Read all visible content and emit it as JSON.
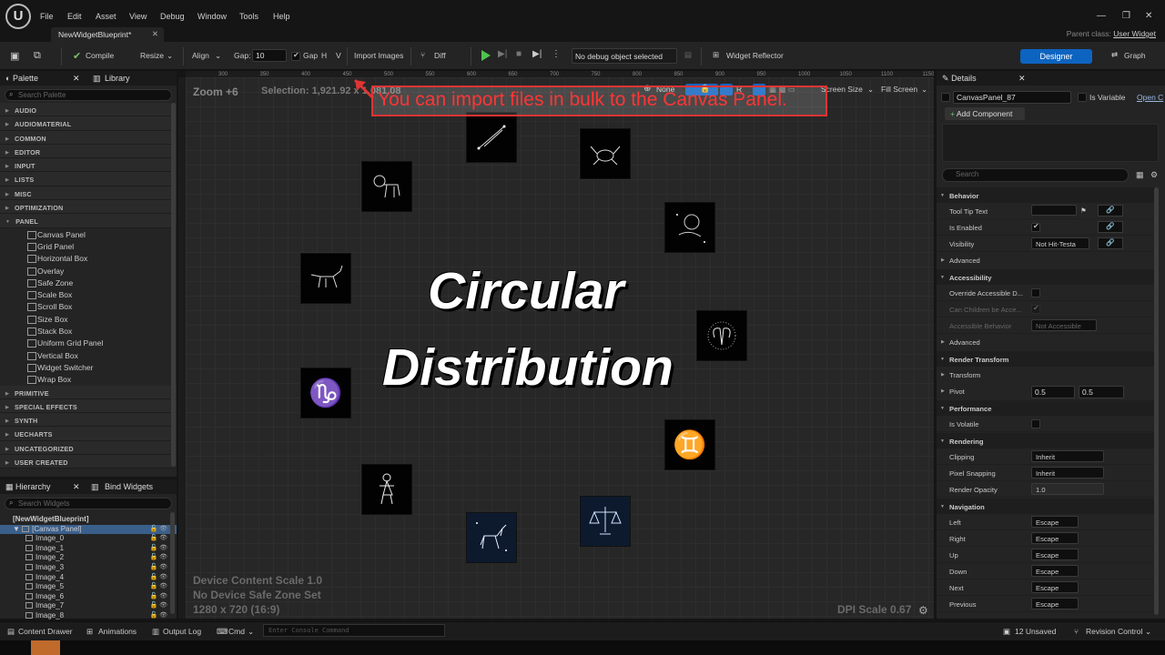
{
  "menu": [
    "File",
    "Edit",
    "Asset",
    "View",
    "Debug",
    "Window",
    "Tools",
    "Help"
  ],
  "asset_tab": "NewWidgetBlueprint*",
  "parent_class": {
    "label": "Parent class:",
    "value": "User Widget"
  },
  "toolbar": {
    "compile": "Compile",
    "resize": "Resize",
    "align": "Align",
    "gap_label": "Gap:",
    "gap_value": "10",
    "gap_toggle": "Gap",
    "h": "H",
    "v": "V",
    "import_images": "Import Images",
    "diff": "Diff",
    "debug_object": "No debug object selected",
    "widget_reflector": "Widget Reflector",
    "designer": "Designer",
    "graph": "Graph"
  },
  "palette": {
    "tab": "Palette",
    "library_tab": "Library",
    "search_placeholder": "Search Palette",
    "categories_top": [
      "AUDIO",
      "AUDIOMATERIAL",
      "COMMON",
      "EDITOR",
      "INPUT",
      "LISTS",
      "MISC",
      "OPTIMIZATION"
    ],
    "panel_category": "PANEL",
    "panel_widgets": [
      "Canvas Panel",
      "Grid Panel",
      "Horizontal Box",
      "Overlay",
      "Safe Zone",
      "Scale Box",
      "Scroll Box",
      "Size Box",
      "Stack Box",
      "Uniform Grid Panel",
      "Vertical Box",
      "Widget Switcher",
      "Wrap Box"
    ],
    "categories_bottom": [
      "PRIMITIVE",
      "SPECIAL EFFECTS",
      "SYNTH",
      "UECHARTS",
      "UNCATEGORIZED",
      "USER CREATED"
    ]
  },
  "hierarchy": {
    "tab": "Hierarchy",
    "bind_tab": "Bind Widgets",
    "search_placeholder": "Search Widgets",
    "root": "[NewWidgetBlueprint]",
    "canvas": "[Canvas Panel]",
    "images": [
      "Image_0",
      "Image_1",
      "Image_2",
      "Image_3",
      "Image_4",
      "Image_5",
      "Image_6",
      "Image_7",
      "Image_8"
    ]
  },
  "designer": {
    "zoom": "Zoom +6",
    "selection": "Selection: 1,921.92 x 1,081.08",
    "tooltip": "You can import files in bulk to the Canvas Panel.",
    "none_label": "None",
    "r_label": "R",
    "screen_size": "Screen Size",
    "fill_screen": "Fill Screen",
    "title_line1": "Circular",
    "title_line2": "Distribution",
    "device_scale": "Device Content Scale 1.0",
    "safe_zone": "No Device Safe Zone Set",
    "resolution": "1280 x 720 (16:9)",
    "dpi": "DPI Scale 0.67",
    "ruler_marks": [
      "300",
      "350",
      "400",
      "450",
      "500",
      "550",
      "600",
      "650",
      "700",
      "750",
      "800",
      "850",
      "900",
      "950",
      "1000",
      "1050",
      "1100",
      "1150"
    ],
    "zodiac_icons": [
      "telescope-icon",
      "crab-cancer-icon",
      "lion-leo-icon",
      "lion-leo-icon",
      "bull-taurus-icon",
      "ram-aries-icon",
      "capricorn-icon",
      "gemini-icon",
      "virgo-icon",
      "libra-icon",
      "unicorn-icon"
    ]
  },
  "details": {
    "tab": "Details",
    "name": "CanvasPanel_87",
    "is_variable": "Is Variable",
    "open": "Open C",
    "add_component": "Add Component",
    "search_placeholder": "Search",
    "behavior": "Behavior",
    "tool_tip": "Tool Tip Text",
    "is_enabled": "Is Enabled",
    "visibility": "Visibility",
    "visibility_value": "Not Hit-Testa",
    "advanced": "Advanced",
    "accessibility": "Accessibility",
    "override_accessible": "Override Accessible D...",
    "can_children": "Can Children be Acce...",
    "accessible_behavior": "Accessible Behavior",
    "accessible_value": "Not Accessible",
    "render_transform": "Render Transform",
    "transform": "Transform",
    "pivot": "Pivot",
    "pivot_x": "0.5",
    "pivot_y": "0.5",
    "performance": "Performance",
    "is_volatile": "Is Volatile",
    "rendering": "Rendering",
    "clipping": "Clipping",
    "clipping_value": "Inherit",
    "pixel_snapping": "Pixel Snapping",
    "pixel_value": "Inherit",
    "render_opacity": "Render Opacity",
    "opacity_value": "1.0",
    "navigation": "Navigation",
    "nav_rows": [
      {
        "label": "Left",
        "value": "Escape"
      },
      {
        "label": "Right",
        "value": "Escape"
      },
      {
        "label": "Up",
        "value": "Escape"
      },
      {
        "label": "Down",
        "value": "Escape"
      },
      {
        "label": "Next",
        "value": "Escape"
      },
      {
        "label": "Previous",
        "value": "Escape"
      }
    ]
  },
  "status": {
    "content_drawer": "Content Drawer",
    "animations": "Animations",
    "output_log": "Output Log",
    "cmd": "Cmd",
    "console_placeholder": "Enter Console Command",
    "unsaved": "12 Unsaved",
    "revision": "Revision Control"
  },
  "colors": {
    "accent": "#0d64c0",
    "tooltip_red": "#ff3535",
    "selected_row": "#3a5f8a"
  }
}
